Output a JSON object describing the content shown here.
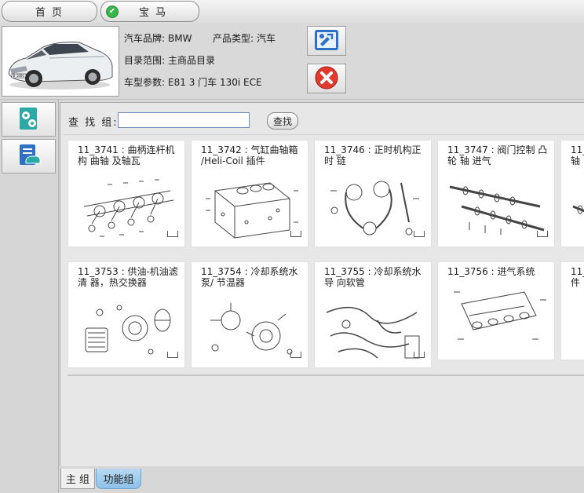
{
  "tabs": {
    "home": "首  页",
    "brand": "宝  马"
  },
  "header": {
    "brand_label": "汽车品牌:",
    "brand_value": "BMW",
    "type_label": "产品类型:",
    "type_value": "汽车",
    "scope_label": "目录范围:",
    "scope_value": "主商品目录",
    "model_label": "车型参数:",
    "model_value": "E81 3 门车 130i ECE",
    "plate_text": "B-1800"
  },
  "search": {
    "label": "查 找 组:",
    "value": "",
    "button": "查找"
  },
  "cards_row1": [
    {
      "title": "11_3741 : 曲柄连杆机构 曲轴 及轴瓦"
    },
    {
      "title": "11_3742 : 气缸曲轴箱 /Heli-Coil 插件"
    },
    {
      "title": "11_3746 : 正时机构正时 链"
    },
    {
      "title": "11_3747 : 阀门控制 凸轮 轴 进气"
    },
    {
      "title": "11_3 轴"
    }
  ],
  "cards_row2": [
    {
      "title": "11_3753 : 供油-机油滤清 器，热交换器"
    },
    {
      "title": "11_3754 : 冷却系统水泵/ 节温器"
    },
    {
      "title": "11_3755 : 冷却系统水导 向软管"
    },
    {
      "title": "11_3756 : 进气系统"
    },
    {
      "title": "11_ 件"
    }
  ],
  "bottom_tabs": {
    "main": "主 组",
    "function": "功能组"
  },
  "colors": {
    "accent_blue": "#2f6fc6",
    "close_red": "#e23a2e",
    "check_green": "#3bb64a",
    "active_tab": "#9ecaec"
  }
}
